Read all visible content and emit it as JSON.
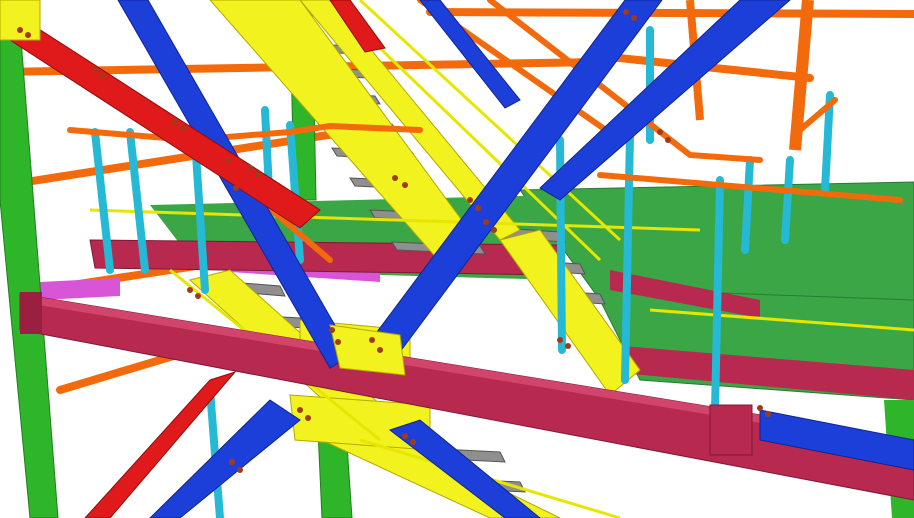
{
  "viewport": {
    "background": "#ffffff"
  },
  "colors": {
    "green_steel": "#2fb52a",
    "green_deck": "#3aa646",
    "orange_pipe": "#f26a0c",
    "cyan_post": "#25b9d6",
    "yellow_stringer": "#f2f21e",
    "blue_brace": "#1c3fd9",
    "crimson_beam": "#b7294f",
    "red_brace": "#e01a1a",
    "magenta_plate": "#d855d8",
    "grey_tread": "#8f8f8f",
    "bolt": "#a23a1a"
  }
}
